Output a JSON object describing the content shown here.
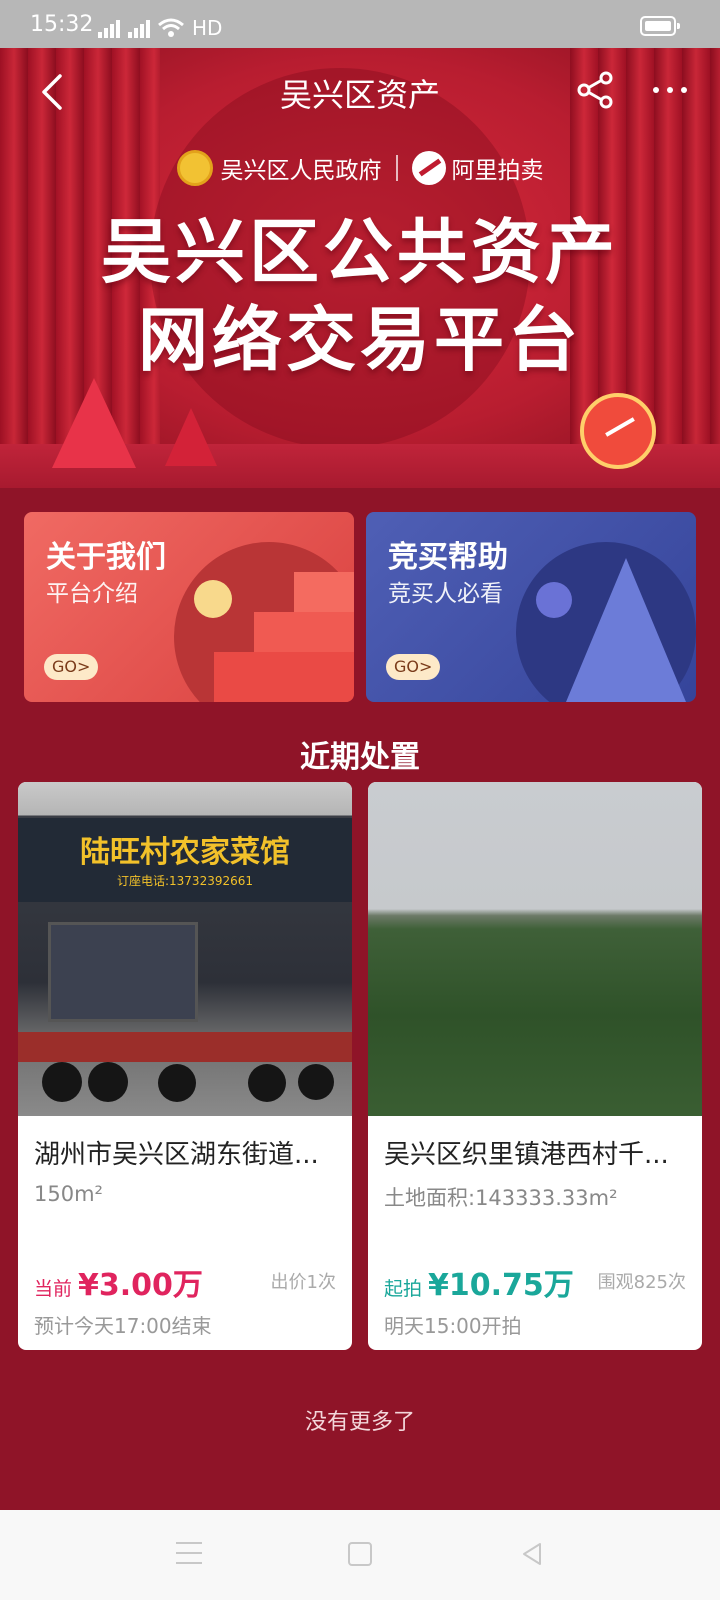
{
  "status_bar": {
    "time": "15:32",
    "network": "4G",
    "hd": "HD"
  },
  "header": {
    "title": "吴兴区资产"
  },
  "banner": {
    "org": "吴兴区人民政府",
    "partner": "阿里拍卖",
    "title_line1": "吴兴区公共资产",
    "title_line2": "网络交易平台"
  },
  "entries": [
    {
      "title": "关于我们",
      "subtitle": "平台介绍",
      "go": "GO>"
    },
    {
      "title": "竞买帮助",
      "subtitle": "竞买人必看",
      "go": "GO>"
    }
  ],
  "section_title": "近期处置",
  "listings": [
    {
      "name": "湖州市吴兴区湖东街道...",
      "area": "150m²",
      "price_label": "当前",
      "price": "¥3.00万",
      "meta": "出价1次",
      "time": "预计今天17:00结束",
      "accent": "#e0245e",
      "photo_sign": "陆旺村农家菜馆",
      "photo_phone": "订座电话:13732392661"
    },
    {
      "name": "吴兴区织里镇港西村千...",
      "area": "土地面积:143333.33m²",
      "price_label": "起拍",
      "price": "¥10.75万",
      "meta": "围观825次",
      "time": "明天15:00开拍",
      "accent": "#1aa79a"
    }
  ],
  "footer": {
    "no_more": "没有更多了"
  },
  "icons": {
    "back": "back-arrow-icon",
    "share": "share-icon",
    "more": "more-dots-icon",
    "nav_menu": "menu-icon",
    "nav_home": "home-square-icon",
    "nav_back": "back-triangle-icon"
  }
}
